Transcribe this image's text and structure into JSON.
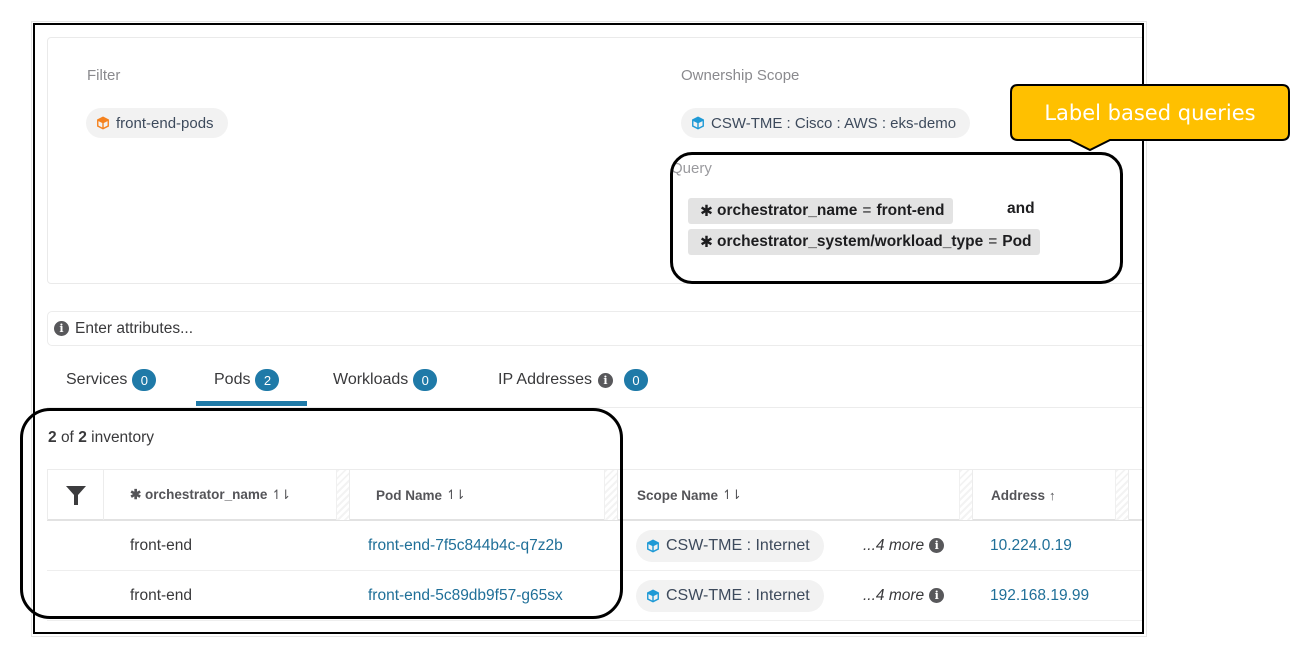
{
  "filter": {
    "label": "Filter",
    "chip": {
      "icon": "cube-icon",
      "text": "front-end-pods",
      "icon_color": "#f5821f"
    }
  },
  "ownership": {
    "label": "Ownership Scope",
    "chip": {
      "icon": "cube-icon",
      "text": "CSW-TME : Cisco : AWS : eks-demo",
      "icon_color": "#1f9ad6"
    }
  },
  "query": {
    "label": "Query",
    "clauses": [
      {
        "star": "✱",
        "key": "orchestrator_name",
        "op": "=",
        "value": "front-end"
      },
      {
        "star": "✱",
        "key": "orchestrator_system/workload_type",
        "op": "=",
        "value": "Pod"
      }
    ],
    "conjunction": "and"
  },
  "callout": {
    "text": "Label based queries",
    "color": "#ffc000"
  },
  "search": {
    "placeholder": "Enter attributes...",
    "icon": "info-icon"
  },
  "tabs": [
    {
      "label": "Services",
      "count": "0",
      "active": false
    },
    {
      "label": "Pods",
      "count": "2",
      "active": true
    },
    {
      "label": "Workloads",
      "count": "0",
      "active": false
    },
    {
      "label": "IP Addresses",
      "count": "0",
      "active": false,
      "info": "i"
    }
  ],
  "inventory": {
    "shown": "2",
    "of_word": "of",
    "total": "2",
    "suffix": "inventory"
  },
  "table": {
    "columns": [
      {
        "label": "✱ orchestrator_name",
        "sort": "↿⇂"
      },
      {
        "label": "Pod Name",
        "sort": "↿⇂"
      },
      {
        "label": "Scope Name",
        "sort": "↿⇂"
      },
      {
        "label": "Address",
        "sort": "↑"
      }
    ],
    "rows": [
      {
        "orchestrator_name": "front-end",
        "pod_name": "front-end-7f5c844b4c-q7z2b",
        "scope": "CSW-TME : Internet",
        "more": "...4 more",
        "address": "10.224.0.19"
      },
      {
        "orchestrator_name": "front-end",
        "pod_name": "front-end-5c89db9f57-g65sx",
        "scope": "CSW-TME : Internet",
        "more": "...4 more",
        "address": "192.168.19.99"
      }
    ]
  },
  "colors": {
    "accent": "#1f7aa8",
    "link": "#1f6f98",
    "annotation": "#000000"
  }
}
